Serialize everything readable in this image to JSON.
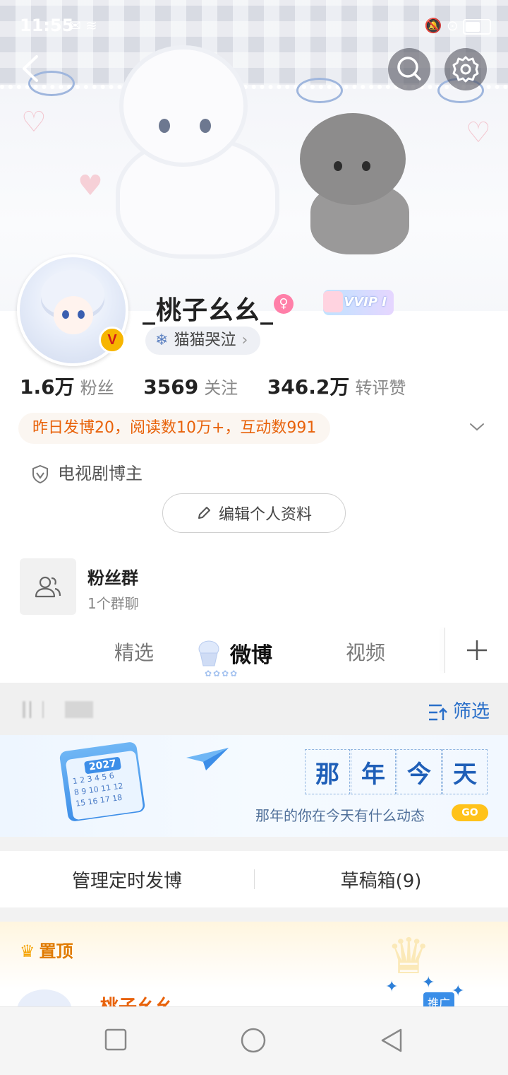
{
  "status_bar": {
    "time": "11:55"
  },
  "profile": {
    "nickname": "_桃子幺幺_",
    "vip_text": "VVIP I",
    "group_tag": "猫猫哭泣",
    "stats": [
      {
        "value": "1.6万",
        "label": "粉丝"
      },
      {
        "value": "3569",
        "label": "关注"
      },
      {
        "value": "346.2万",
        "label": "转评赞"
      }
    ],
    "activity": "昨日发博20，阅读数10万+，互动数991",
    "identity": "电视剧博主",
    "edit_button": "编辑个人资料"
  },
  "fan_group": {
    "title": "粉丝群",
    "subtitle": "1个群聊"
  },
  "tabs": [
    {
      "label": "精选"
    },
    {
      "label": "微博"
    },
    {
      "label": "视频"
    }
  ],
  "filter": {
    "label": "筛选"
  },
  "memory_banner": {
    "year": "2027",
    "title_chars": [
      "那",
      "年",
      "今",
      "天"
    ],
    "subtitle": "那年的你在今天有什么动态",
    "go": "GO"
  },
  "manage": {
    "scheduled": "管理定时发博",
    "drafts": "草稿箱(9)"
  },
  "pinned": {
    "label": "置顶",
    "peek_name": "桃子幺幺",
    "promo": "推广"
  },
  "colors": {
    "accent_orange": "#e8620a",
    "link_blue": "#2a6fc9",
    "vip_gold": "#f7b500"
  }
}
